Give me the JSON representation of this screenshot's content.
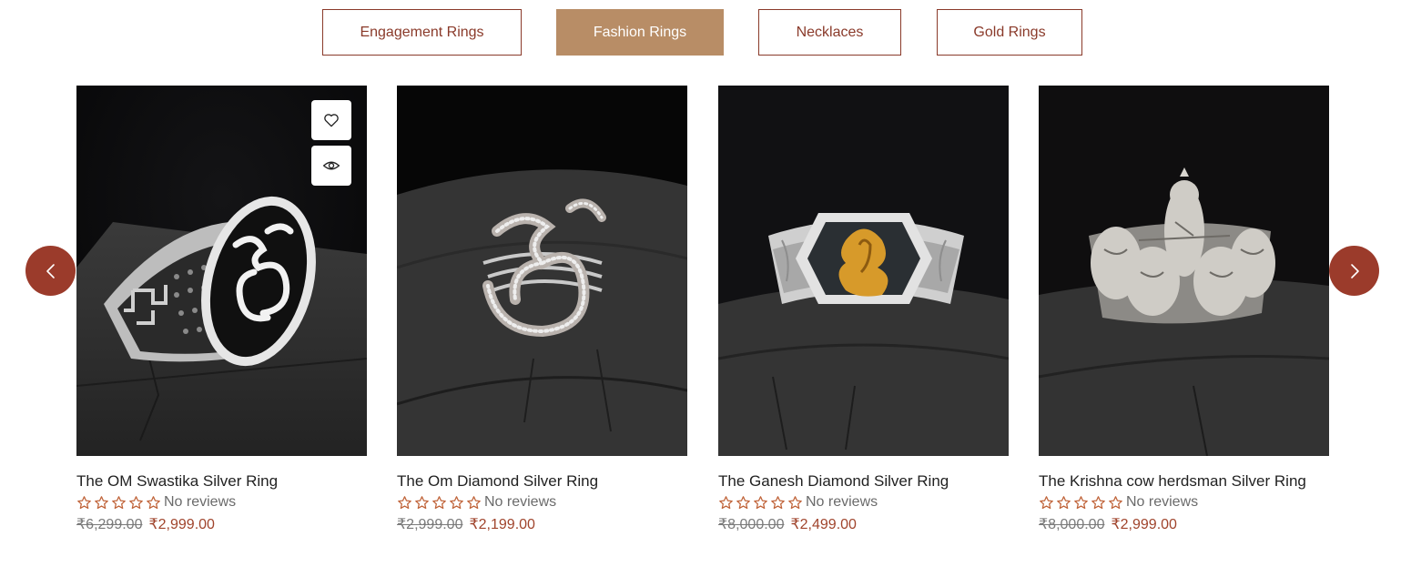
{
  "tabs": [
    {
      "label": "Engagement Rings",
      "active": false
    },
    {
      "label": "Fashion Rings",
      "active": true
    },
    {
      "label": "Necklaces",
      "active": false
    },
    {
      "label": "Gold Rings",
      "active": false
    }
  ],
  "products": [
    {
      "title": "The OM Swastika Silver Ring",
      "reviews": "No reviews",
      "old_price": "₹6,299.00",
      "price": "₹2,999.00",
      "rating": 0,
      "image": "om-swastika-ring-photo"
    },
    {
      "title": "The Om Diamond Silver Ring",
      "reviews": "No reviews",
      "old_price": "₹2,999.00",
      "price": "₹2,199.00",
      "rating": 0,
      "image": "om-diamond-ring-photo"
    },
    {
      "title": "The Ganesh Diamond Silver Ring",
      "reviews": "No reviews",
      "old_price": "₹8,000.00",
      "price": "₹2,499.00",
      "rating": 0,
      "image": "ganesh-ring-photo"
    },
    {
      "title": "The Krishna cow herdsman Silver Ring",
      "reviews": "No reviews",
      "old_price": "₹8,000.00",
      "price": "₹2,999.00",
      "rating": 0,
      "image": "krishna-ring-photo"
    }
  ],
  "icons": {
    "wishlist": "heart-icon",
    "quick_view": "eye-icon",
    "prev": "chevron-left-icon",
    "next": "chevron-right-icon",
    "star": "star-outline-icon"
  },
  "colors": {
    "accent": "#9b3b2b",
    "active_tab": "#b88d66",
    "sale_price": "#a0442c",
    "star": "#c0643a"
  }
}
